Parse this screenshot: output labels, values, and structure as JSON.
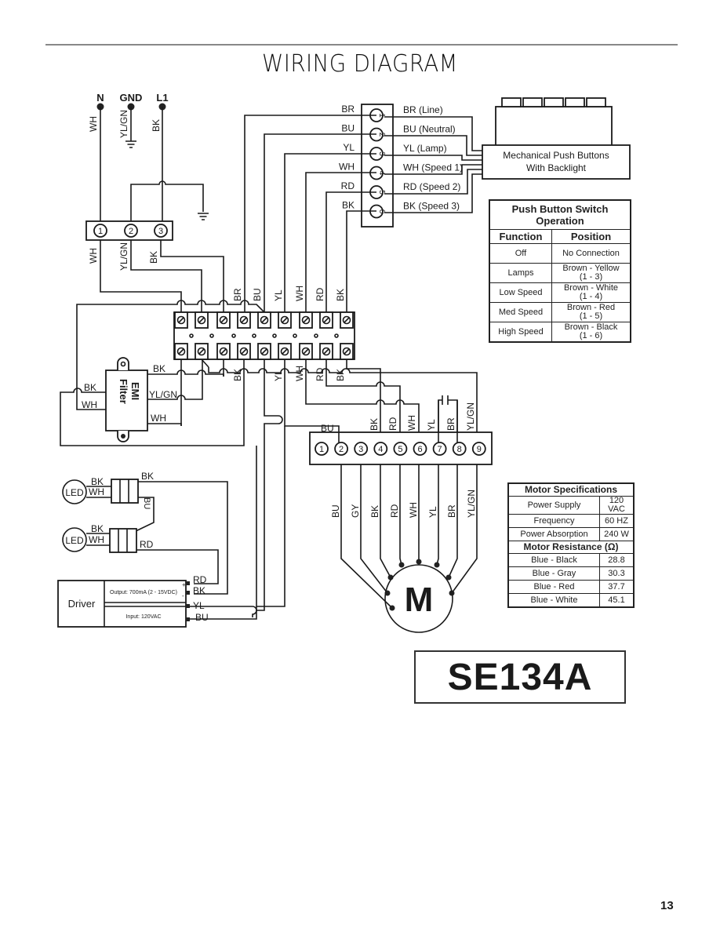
{
  "page": {
    "title": "WIRING DIAGRAM",
    "page_number": "13",
    "model": "SE134A"
  },
  "supply": {
    "terminals": [
      {
        "label": "N",
        "wire": "WH"
      },
      {
        "label": "GND",
        "wire": "YL/GN"
      },
      {
        "label": "L1",
        "wire": "BK"
      }
    ],
    "block_numbers": [
      "1",
      "2",
      "3"
    ],
    "block_wire_labels": [
      "WH",
      "YL/GN",
      "BK"
    ]
  },
  "switch_connector": {
    "left_labels": [
      "BR",
      "BU",
      "YL",
      "WH",
      "RD",
      "BK"
    ],
    "pins": [
      "1",
      "2",
      "3",
      "4",
      "5",
      "6"
    ],
    "right_labels": [
      "BR (Line)",
      "BU (Neutral)",
      "YL (Lamp)",
      "WH (Speed 1)",
      "RD (Speed 2)",
      "BK (Speed 3)"
    ]
  },
  "push_buttons": {
    "label_line1": "Mechanical Push Buttons",
    "label_line2": "With Backlight",
    "button_count": 5
  },
  "terminal_strip": {
    "top_wire_labels": [
      "BR",
      "BU",
      "YL",
      "WH",
      "RD",
      "BK"
    ],
    "bottom_wire_labels": [
      "BK",
      "YL",
      "WH",
      "RD",
      "BK"
    ]
  },
  "emi_filter": {
    "label_line1": "EMI",
    "label_line2": "Filter",
    "left_labels": [
      "BK",
      "WH"
    ],
    "right_labels": [
      "BK",
      "YL/GN",
      "WH"
    ]
  },
  "motor_connector": {
    "top_labels": [
      "BU",
      "BK",
      "RD",
      "WH",
      "YL",
      "BR",
      "YL/GN"
    ],
    "pins": [
      "1",
      "2",
      "3",
      "4",
      "5",
      "6",
      "7",
      "8",
      "9"
    ],
    "motor_wire_labels": [
      "BU",
      "GY",
      "BK",
      "RD",
      "WH",
      "YL",
      "BR",
      "YL/GN"
    ],
    "motor_symbol": "M"
  },
  "leds": [
    {
      "label": "LED",
      "wires": [
        "BK",
        "WH"
      ],
      "out_wire": "BK",
      "link_wire": "BU"
    },
    {
      "label": "LED",
      "wires": [
        "BK",
        "WH"
      ],
      "out_wire": "RD"
    }
  ],
  "driver": {
    "label": "Driver",
    "output_text": "Output: 700mA (2 - 15VDC)",
    "input_text": "Input: 120VAC",
    "polarity": [
      "+",
      "-"
    ],
    "terminal_labels": [
      "RD",
      "BK",
      "YL",
      "BU"
    ]
  },
  "push_button_table": {
    "title_line1": "Push Button Switch",
    "title_line2": "Operation",
    "columns": [
      "Function",
      "Position"
    ],
    "rows": [
      {
        "function": "Off",
        "position": "No Connection",
        "pins": ""
      },
      {
        "function": "Lamps",
        "position": "Brown - Yellow",
        "pins": "(1 - 3)"
      },
      {
        "function": "Low Speed",
        "position": "Brown - White",
        "pins": "(1 - 4)"
      },
      {
        "function": "Med Speed",
        "position": "Brown - Red",
        "pins": "(1 - 5)"
      },
      {
        "function": "High Speed",
        "position": "Brown - Black",
        "pins": "(1 - 6)"
      }
    ]
  },
  "motor_table": {
    "spec_title": "Motor Specifications",
    "specs": [
      {
        "name": "Power Supply",
        "value": "120 VAC"
      },
      {
        "name": "Frequency",
        "value": "60 HZ"
      },
      {
        "name": "Power Absorption",
        "value": "240 W"
      }
    ],
    "resistance_title": "Motor Resistance (Ω)",
    "resistance": [
      {
        "pair": "Blue - Black",
        "ohms": "28.8"
      },
      {
        "pair": "Blue - Gray",
        "ohms": "30.3"
      },
      {
        "pair": "Blue - Red",
        "ohms": "37.7"
      },
      {
        "pair": "Blue - White",
        "ohms": "45.1"
      }
    ]
  }
}
